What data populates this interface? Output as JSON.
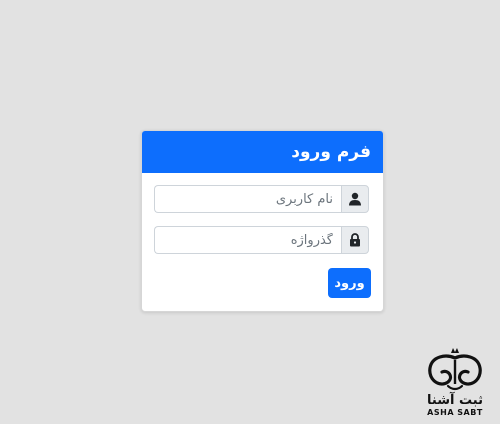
{
  "login_card": {
    "title": "فرم ورود",
    "username": {
      "placeholder": "نام کاربری",
      "value": "",
      "icon": "user-icon"
    },
    "password": {
      "placeholder": "گذرواژه",
      "value": "",
      "icon": "lock-icon"
    },
    "submit_label": "ورود"
  },
  "watermark": {
    "text_fa": "ثبت آشنا",
    "text_en": "ASHA SABT"
  },
  "colors": {
    "background": "#e2e2e2",
    "primary": "#0d6efd",
    "addon": "#e9ecef"
  }
}
